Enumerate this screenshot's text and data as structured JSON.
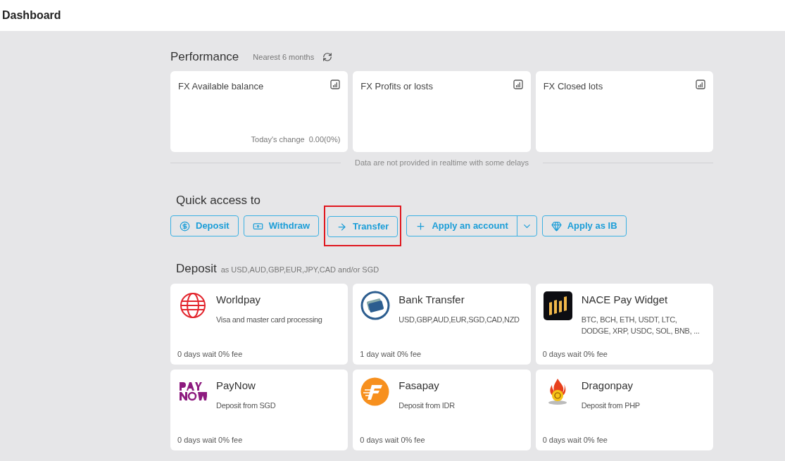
{
  "header": {
    "title": "Dashboard"
  },
  "performance": {
    "title": "Performance",
    "period": "Nearest 6 months",
    "cards": [
      {
        "title": "FX Available balance",
        "change_label": "Today's change",
        "change_value": "0.00(0%)"
      },
      {
        "title": "FX Profits or losts"
      },
      {
        "title": "FX Closed lots"
      }
    ],
    "note": "Data are not provided in realtime with some delays"
  },
  "quick_access": {
    "title": "Quick access to",
    "buttons": [
      {
        "kind": "deposit",
        "label": "Deposit",
        "highlighted": false,
        "dropdown": false
      },
      {
        "kind": "withdraw",
        "label": "Withdraw",
        "highlighted": false,
        "dropdown": false
      },
      {
        "kind": "transfer",
        "label": "Transfer",
        "highlighted": true,
        "dropdown": false
      },
      {
        "kind": "account",
        "label": "Apply an account",
        "highlighted": false,
        "dropdown": true
      },
      {
        "kind": "ib",
        "label": "Apply as IB",
        "highlighted": false,
        "dropdown": false
      }
    ]
  },
  "deposit": {
    "title": "Deposit",
    "subtitle": "as USD,AUD,GBP,EUR,JPY,CAD and/or SGD",
    "methods": [
      {
        "kind": "worldpay",
        "name": "Worldpay",
        "description": "Visa and master card processing",
        "terms": "0 days wait 0% fee"
      },
      {
        "kind": "bank",
        "name": "Bank Transfer",
        "description": "USD,GBP,AUD,EUR,SGD,CAD,NZD",
        "terms": "1 day wait 0% fee"
      },
      {
        "kind": "nace",
        "name": "NACE Pay Widget",
        "description": "BTC, BCH, ETH, USDT, LTC, DODGE, XRP, USDC, SOL, BNB, ...",
        "terms": "0 days wait 0% fee"
      },
      {
        "kind": "paynow",
        "name": "PayNow",
        "description": "Deposit from SGD",
        "terms": "0 days wait 0% fee"
      },
      {
        "kind": "fasapay",
        "name": "Fasapay",
        "description": "Deposit from IDR",
        "terms": "0 days wait 0% fee"
      },
      {
        "kind": "dragonpay",
        "name": "Dragonpay",
        "description": "Deposit from PHP",
        "terms": "0 days wait 0% fee"
      }
    ]
  }
}
